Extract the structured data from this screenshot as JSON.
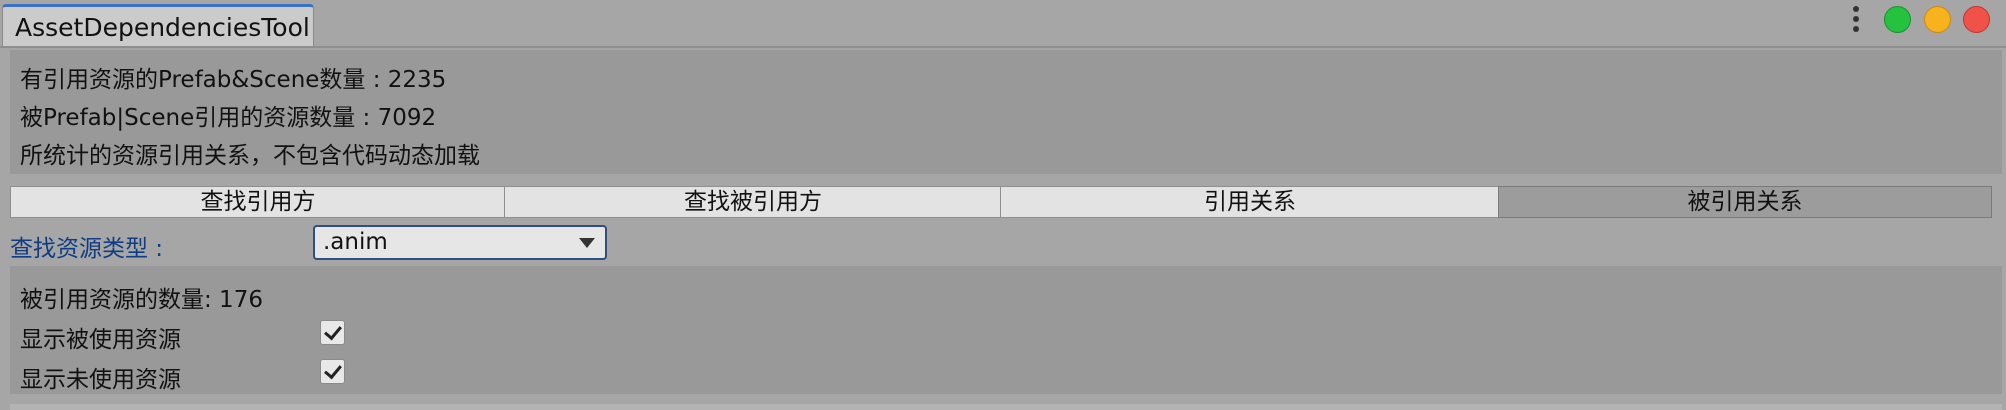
{
  "window": {
    "tab_title": "AssetDependenciesTool",
    "menu_icon": "kebab-menu-icon",
    "lights": [
      "green",
      "yellow",
      "red"
    ]
  },
  "summary": {
    "line1": "有引用资源的Prefab&Scene数量 : 2235",
    "line2": "被Prefab|Scene引用的资源数量 : 7092",
    "line3": "所统计的资源引用关系，不包含代码动态加载"
  },
  "toolbar": {
    "items": [
      {
        "label": "查找引用方",
        "active": false
      },
      {
        "label": "查找被引用方",
        "active": false
      },
      {
        "label": "引用关系",
        "active": false
      },
      {
        "label": "被引用关系",
        "active": true
      }
    ]
  },
  "filter": {
    "label": "查找资源类型 :",
    "selected": ".anim"
  },
  "results": {
    "count_text": "被引用资源的数量: 176",
    "show_used_label": "显示被使用资源",
    "show_used_checked": true,
    "show_unused_label": "显示未使用资源",
    "show_unused_checked": true
  },
  "colors": {
    "accent": "#3a72c4",
    "label_blue": "#103d82",
    "panel_bg": "#999999",
    "window_bg": "#a6a6a6"
  }
}
